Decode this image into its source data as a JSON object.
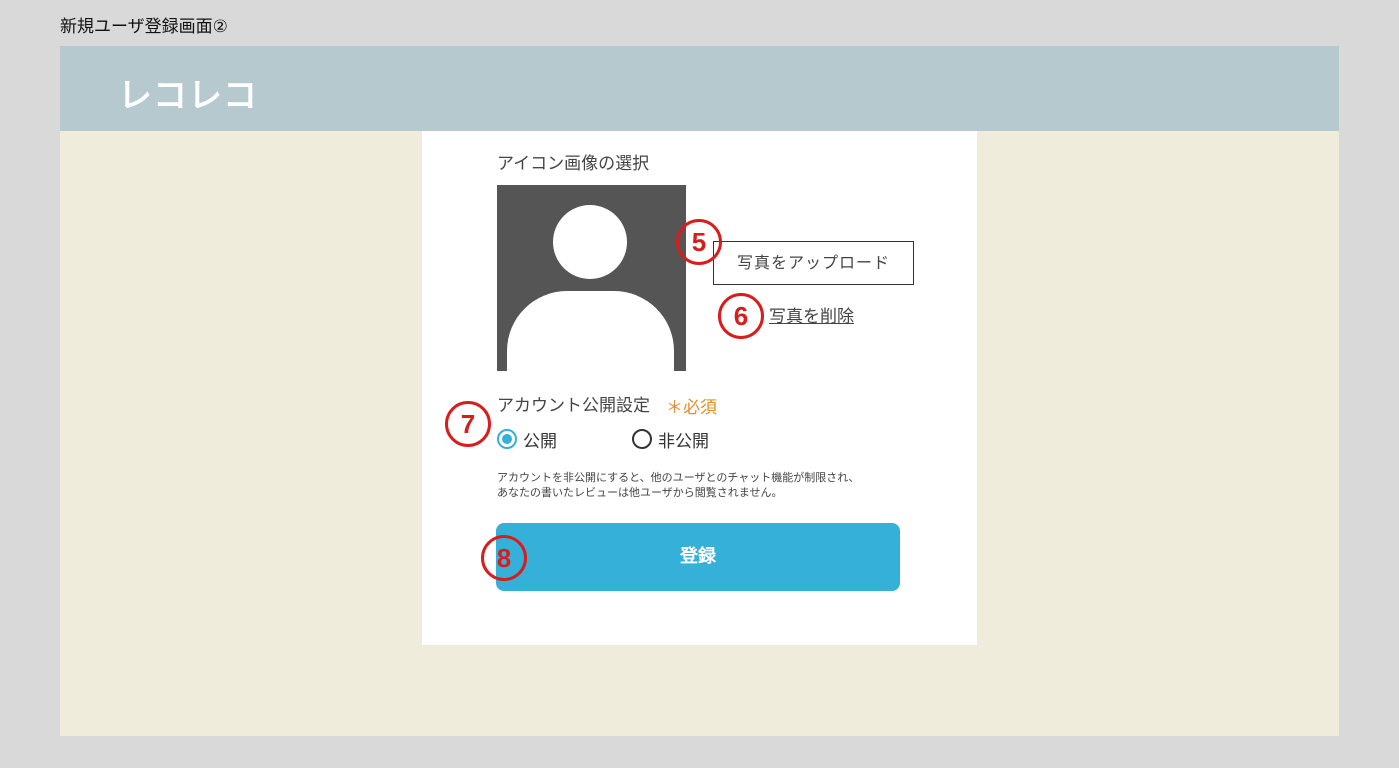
{
  "page_caption": "新規ユーザ登録画面②",
  "header": {
    "logo": "レコレコ"
  },
  "card": {
    "section_title": "アイコン画像の選択",
    "upload_button": "写真をアップロード",
    "delete_link": "写真を削除",
    "privacy_label": "アカウント公開設定",
    "required_mark": "＊必須",
    "radio_public": "公開",
    "radio_private": "非公開",
    "note_line1": "アカウントを非公開にすると、他のユーザとのチャット機能が制限され、",
    "note_line2": "あなたの書いたレビューは他ユーザから閲覧されません。",
    "register_button": "登録",
    "selected_privacy": "公開"
  },
  "markers": {
    "m5": "5",
    "m6": "6",
    "m7": "7",
    "m8": "8"
  },
  "colors": {
    "header_bg": "#b5c9cf",
    "frame_bg": "#f0ecdc",
    "accent": "#35b0d9",
    "required": "#e0902a",
    "marker": "#d91c1c"
  },
  "icons": {
    "avatar": "user-silhouette-icon"
  }
}
